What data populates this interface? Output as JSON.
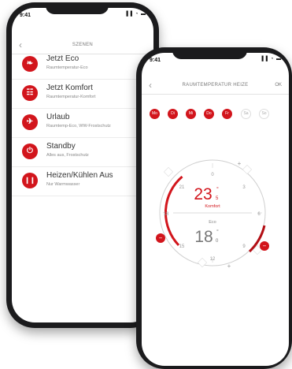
{
  "phone_left": {
    "status": {
      "time": "9:41",
      "icons": "▐▐ ◔ ▬"
    },
    "nav": {
      "back": "‹",
      "title": "SZENEN"
    },
    "scenes": [
      {
        "icon": "leaf-icon",
        "glyph": "❧",
        "title": "Jetzt Eco",
        "subtitle": "Raumtemperatur-Eco"
      },
      {
        "icon": "sofa-icon",
        "glyph": "☷",
        "title": "Jetzt Komfort",
        "subtitle": "Raumtemperatur-Komfort"
      },
      {
        "icon": "airplane-icon",
        "glyph": "✈",
        "title": "Urlaub",
        "subtitle": "Raumtemp-Eco, WW-Frostschutz"
      },
      {
        "icon": "power-icon",
        "glyph": "⏻",
        "title": "Standby",
        "subtitle": "Alles aus, Frostschutz"
      },
      {
        "icon": "pause-icon",
        "glyph": "❙❙",
        "title": "Heizen/Kühlen Aus",
        "subtitle": "Nur Warmwasser"
      }
    ]
  },
  "phone_right": {
    "status": {
      "time": "9:41",
      "icons": "▐▐ ◔ ▬"
    },
    "nav": {
      "back": "‹",
      "title": "RAUMTEMPERATUR HEIZE",
      "ok": "OK"
    },
    "days": [
      {
        "label": "Mo",
        "active": true
      },
      {
        "label": "Di",
        "active": true
      },
      {
        "label": "Mi",
        "active": true
      },
      {
        "label": "Do",
        "active": true
      },
      {
        "label": "Fr",
        "active": true
      },
      {
        "label": "Sa",
        "active": false
      },
      {
        "label": "So",
        "active": false
      }
    ],
    "dial": {
      "hours": [
        "0",
        "3",
        "6",
        "9",
        "12",
        "15",
        "18",
        "21"
      ],
      "komfort": {
        "value": "23",
        "decimal": "5",
        "unit": "°",
        "label": "Komfort"
      },
      "eco": {
        "value": "18",
        "decimal": "0",
        "unit": "°",
        "label": "Eco"
      },
      "plus": "+",
      "minus": "−"
    },
    "accent": "#d2151c"
  }
}
